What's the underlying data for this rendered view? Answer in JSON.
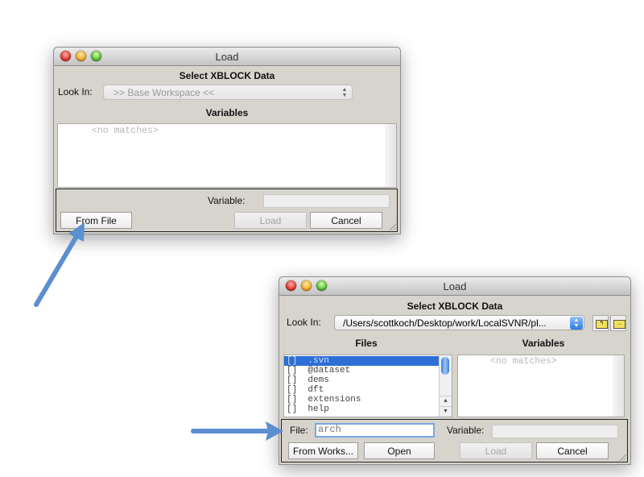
{
  "window1": {
    "title": "Load",
    "heading": "Select XBLOCK Data",
    "look_in_label": "Look In:",
    "look_in_value": ">> Base Workspace <<",
    "variables_heading": "Variables",
    "variables_empty": "<no matches>",
    "variable_label": "Variable:",
    "variable_value": "",
    "buttons": {
      "from_file": "From File",
      "load": "Load",
      "cancel": "Cancel"
    }
  },
  "window2": {
    "title": "Load",
    "heading": "Select XBLOCK Data",
    "look_in_label": "Look In:",
    "look_in_value": "/Users/scottkoch/Desktop/work/LocalSVNR/pl...",
    "files_heading": "Files",
    "variables_heading": "Variables",
    "files": [
      {
        "label": "[]  .svn",
        "selected": true
      },
      {
        "label": "[]  @dataset",
        "selected": false
      },
      {
        "label": "[]  dems",
        "selected": false
      },
      {
        "label": "[]  dft",
        "selected": false
      },
      {
        "label": "[]  extensions",
        "selected": false
      },
      {
        "label": "[]  help",
        "selected": false
      }
    ],
    "variables_empty": "<no matches>",
    "file_label": "File:",
    "file_value": "arch",
    "variable_label": "Variable:",
    "variable_value": "",
    "buttons": {
      "from_workspace": "From Works...",
      "open": "Open",
      "load": "Load",
      "cancel": "Cancel"
    }
  },
  "colors": {
    "arrow": "#5b8fd0",
    "selection": "#2d6fd6"
  }
}
